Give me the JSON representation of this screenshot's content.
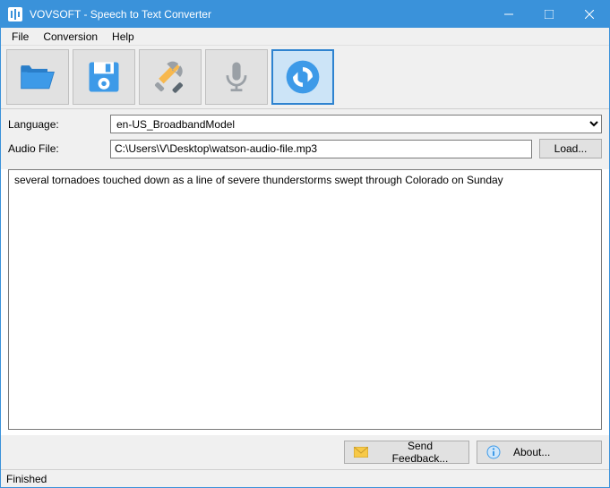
{
  "window": {
    "title": "VOVSOFT - Speech to Text Converter"
  },
  "menu": {
    "file": "File",
    "conversion": "Conversion",
    "help": "Help"
  },
  "form": {
    "language_label": "Language:",
    "language_value": "en-US_BroadbandModel",
    "audio_label": "Audio File:",
    "audio_value": "C:\\Users\\V\\Desktop\\watson-audio-file.mp3",
    "load_label": "Load..."
  },
  "output": {
    "text": "several tornadoes touched down as a line of severe thunderstorms swept through Colorado on Sunday"
  },
  "buttons": {
    "feedback": "Send Feedback...",
    "about": "About..."
  },
  "status": {
    "text": "Finished"
  }
}
